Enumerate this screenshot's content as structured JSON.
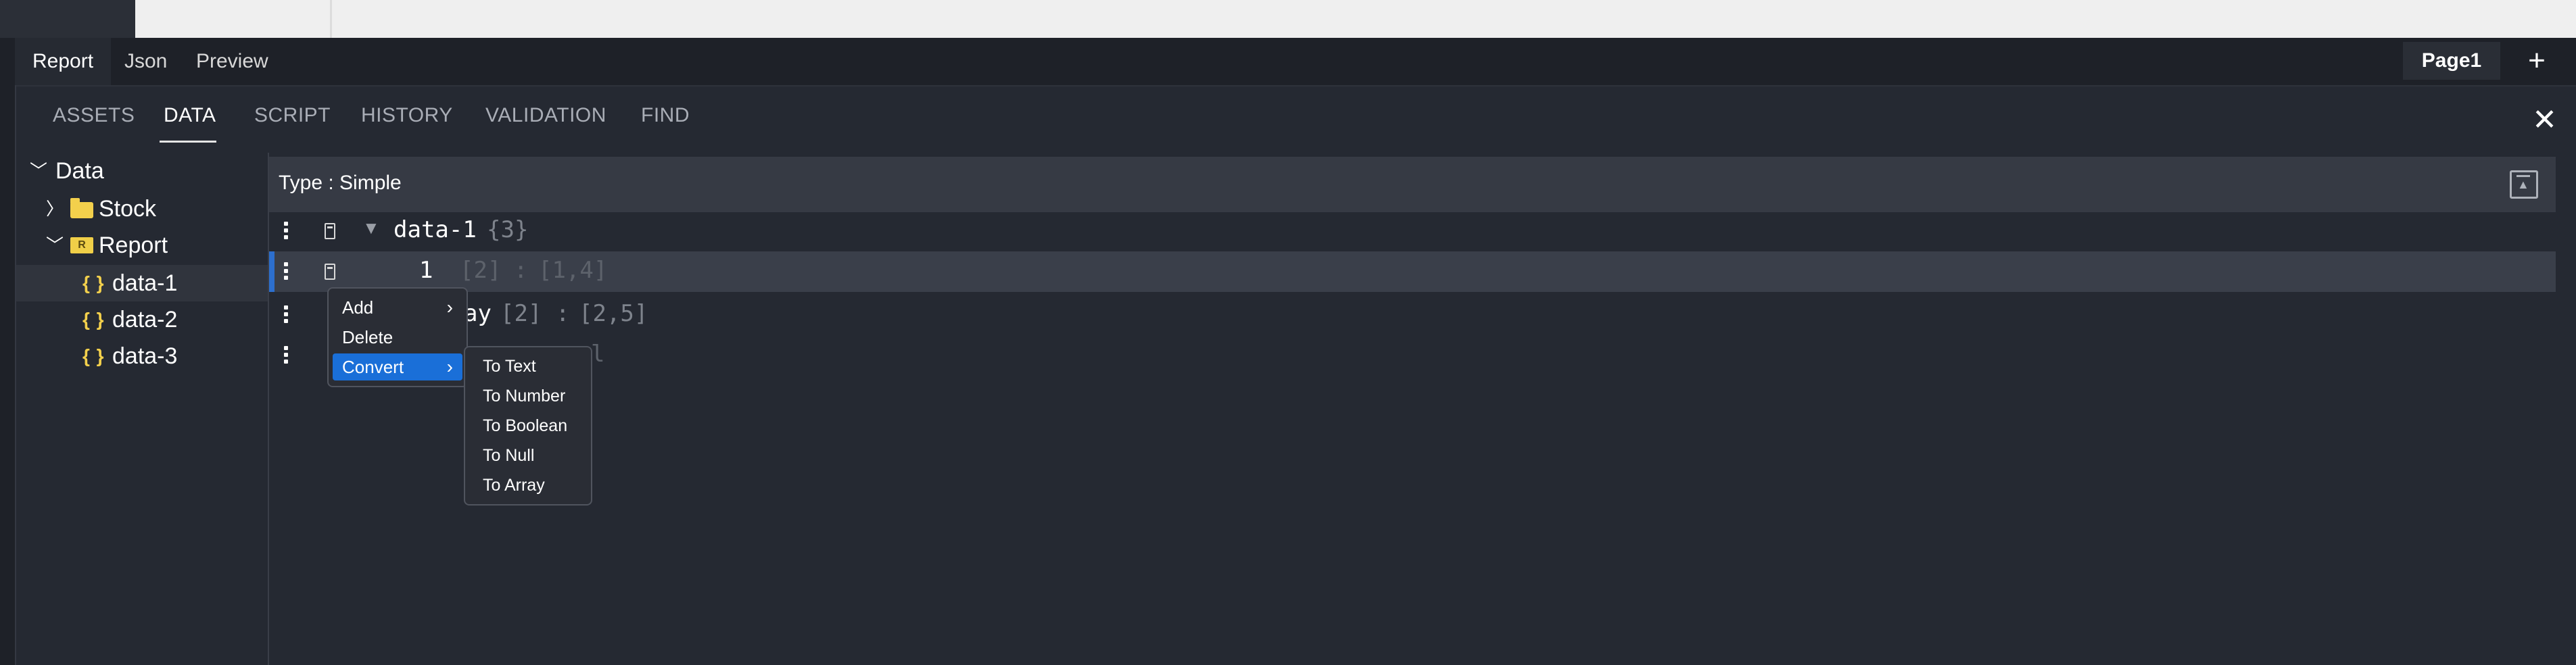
{
  "mode_tabs": [
    "Report",
    "Json",
    "Preview"
  ],
  "page_tab": "Page1",
  "add_page_icon": "plus-icon",
  "panel_tabs": [
    "ASSETS",
    "DATA",
    "SCRIPT",
    "HISTORY",
    "VALIDATION",
    "FIND"
  ],
  "active_panel_tab": "DATA",
  "close_icon": "close-icon",
  "tree": {
    "root": "Data",
    "items": [
      {
        "label": "Stock",
        "icon": "folder-icon",
        "expanded": false
      },
      {
        "label": "Report",
        "icon": "report-icon",
        "expanded": true
      },
      {
        "label": "data-1",
        "icon": "braces-icon",
        "selected": true
      },
      {
        "label": "data-2",
        "icon": "braces-icon"
      },
      {
        "label": "data-3",
        "icon": "braces-icon"
      }
    ]
  },
  "data_header": {
    "type_label": "Type : Simple",
    "export_icon": "export-icon"
  },
  "rows": [
    {
      "key": "data-1",
      "meta": "{3}"
    },
    {
      "key": "1",
      "meta": "[2]",
      "sep": ":",
      "value": "[1,4]"
    },
    {
      "key": "ay",
      "meta": "[2]",
      "sep": ":",
      "value": "[2,5]"
    },
    {
      "key": "",
      "meta": "",
      "sep": "",
      "value": "l"
    }
  ],
  "context_menu": {
    "items": [
      {
        "label": "Add",
        "submenu": true
      },
      {
        "label": "Delete",
        "submenu": false
      },
      {
        "label": "Convert",
        "submenu": true,
        "active": true
      }
    ]
  },
  "convert_submenu": [
    "To Text",
    "To Number",
    "To Boolean",
    "To Null",
    "To Array"
  ],
  "colors": {
    "accent": "#1a6fd8",
    "selection_bar": "#2d6fce",
    "folder": "#f3d04c"
  }
}
